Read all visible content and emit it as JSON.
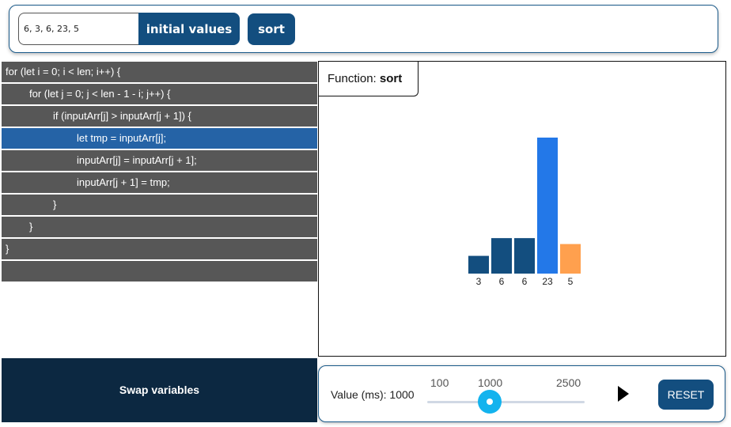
{
  "header": {
    "input_value": "6, 3, 6, 23, 5",
    "initial_values_label": "initial values",
    "sort_label": "sort"
  },
  "code": {
    "lines": [
      {
        "text": "for (let i = 0; i < len; i++) {",
        "indent": 0,
        "active": false
      },
      {
        "text": "for (let j = 0; j < len - 1 - i; j++) {",
        "indent": 1,
        "active": false
      },
      {
        "text": "if (inputArr[j] > inputArr[j + 1]) {",
        "indent": 2,
        "active": false
      },
      {
        "text": "let tmp = inputArr[j];",
        "indent": 3,
        "active": true
      },
      {
        "text": "inputArr[j] = inputArr[j + 1];",
        "indent": 3,
        "active": false
      },
      {
        "text": "inputArr[j + 1] = tmp;",
        "indent": 3,
        "active": false
      },
      {
        "text": "}",
        "indent": 2,
        "active": false
      },
      {
        "text": "}",
        "indent": 1,
        "active": false
      },
      {
        "text": "}",
        "indent": 0,
        "active": false
      },
      {
        "text": "",
        "indent": 0,
        "active": false
      }
    ]
  },
  "visualization": {
    "function_prefix": "Function: ",
    "function_name": "sort"
  },
  "chart_data": {
    "type": "bar",
    "categories": [
      "3",
      "6",
      "6",
      "23",
      "5"
    ],
    "values": [
      3,
      6,
      6,
      23,
      5
    ],
    "highlight": [
      "default",
      "default",
      "default",
      "compare",
      "swap"
    ],
    "colors": {
      "default": "#134e7f",
      "compare": "#2378e8",
      "swap": "#ffa04e"
    }
  },
  "step": {
    "label": "Swap variables"
  },
  "controls": {
    "value_text": "Value (ms): 1000",
    "slider_min": "100",
    "slider_value": "1000",
    "slider_max": "2500",
    "reset_label": "RESET"
  }
}
